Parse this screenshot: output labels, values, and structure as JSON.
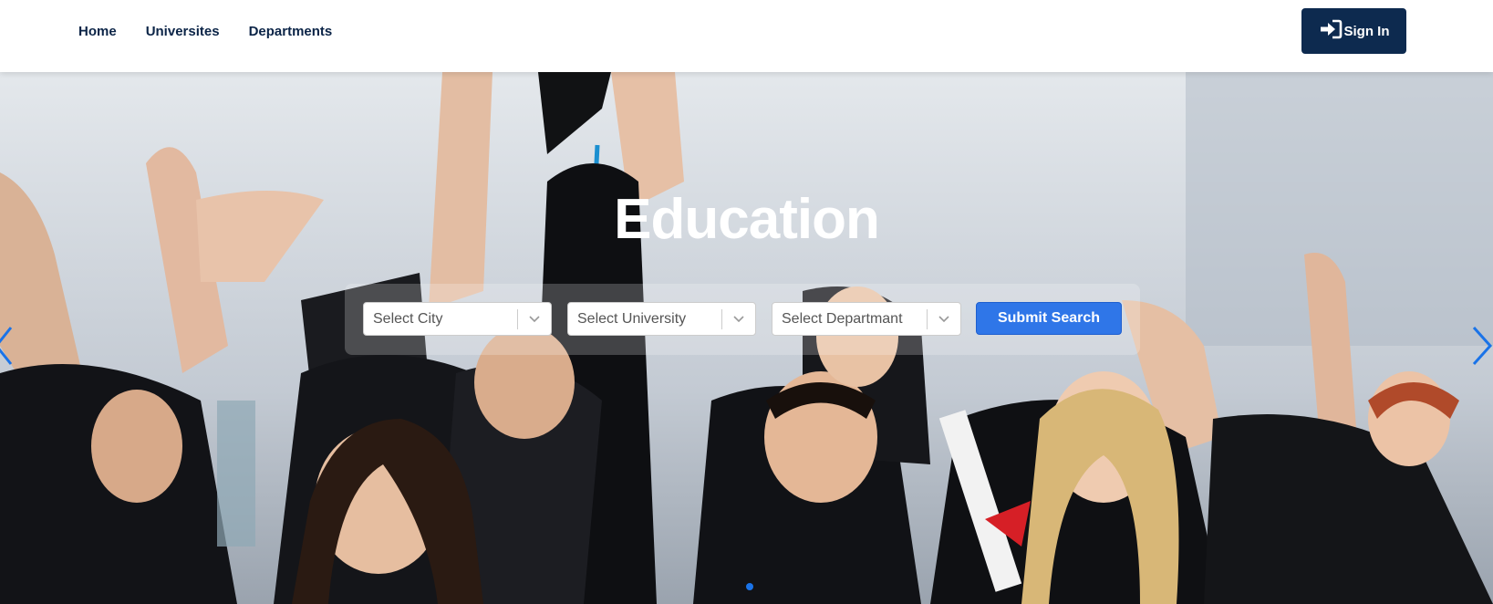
{
  "nav": {
    "links": [
      "Home",
      "Universites",
      "Departments"
    ],
    "signin_label": "Sign In",
    "signin_icon": "sign-in-icon"
  },
  "hero": {
    "title": "Education",
    "image": "graduates-celebrating-photo"
  },
  "search": {
    "city_placeholder": "Select City",
    "university_placeholder": "Select University",
    "department_placeholder": "Select Departmant",
    "submit_label": "Submit Search"
  },
  "carousel": {
    "prev_icon": "chevron-left-icon",
    "next_icon": "chevron-right-icon",
    "active_slide": 1,
    "slide_count": 1
  },
  "colors": {
    "nav_text": "#0b2447",
    "signin_bg": "#0d2a4f",
    "submit_bg": "#2f76e8",
    "accent": "#1a73e8"
  }
}
